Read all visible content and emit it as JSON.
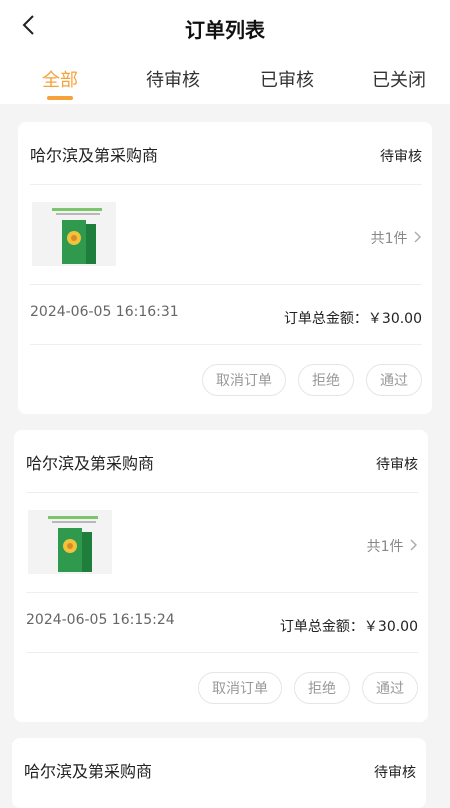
{
  "header": {
    "title": "订单列表",
    "back_icon": "chevron-left-icon"
  },
  "tabs": [
    {
      "label": "全部",
      "active": true
    },
    {
      "label": "待审核",
      "active": false
    },
    {
      "label": "已审核",
      "active": false
    },
    {
      "label": "已关闭",
      "active": false
    }
  ],
  "orders": [
    {
      "store": "哈尔滨及第采购商",
      "status": "待审核",
      "count": "共1件",
      "date": "2024-06-05 16:16:31",
      "total": "订单总金额：￥30.00",
      "actions": [
        "取消订单",
        "拒绝",
        "通过"
      ]
    },
    {
      "store": "哈尔滨及第采购商",
      "status": "待审核",
      "count": "共1件",
      "date": "2024-06-05 16:15:24",
      "total": "订单总金额：￥30.00",
      "actions": [
        "取消订单",
        "拒绝",
        "通过"
      ]
    },
    {
      "store": "哈尔滨及第采购商",
      "status": "待审核"
    }
  ],
  "colors": {
    "accent": "#f5a23a",
    "background": "#f4f4f4",
    "card": "#ffffff"
  }
}
